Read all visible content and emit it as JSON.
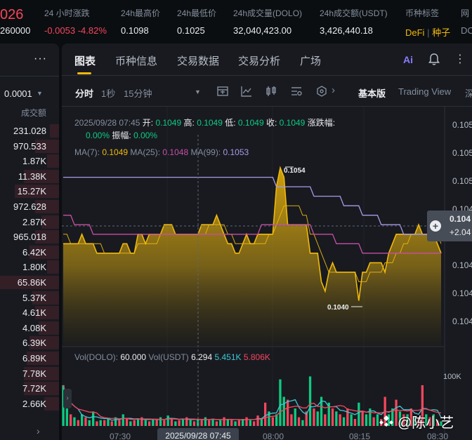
{
  "ticker": {
    "last_price": "026",
    "sub_price": "260000",
    "change_label": "24 小时涨跌",
    "change_value": "-0.0053 -4.82%",
    "high_label": "24h最高价",
    "high_value": "0.1098",
    "low_label": "24h最低价",
    "low_value": "0.1025",
    "vol_base_label": "24h成交量(DOLO)",
    "vol_base_value": "32,040,423.00",
    "vol_quote_label": "24h成交额(USDT)",
    "vol_quote_value": "3,426,440.18",
    "tag_label": "币种标签",
    "tag_defi": "DeFi",
    "tag_sep": "|",
    "tag_seed": "种子",
    "extra_label": "网",
    "extra_value": "DO"
  },
  "orderbook": {
    "menu": "···",
    "step": "0.0001",
    "header": "成交额",
    "rows": [
      "231.028",
      "970.533",
      "1.87K",
      "11.38K",
      "15.27K",
      "972.628",
      "2.87K",
      "965.018",
      "6.42K",
      "1.80K",
      "65.86K",
      "5.37K",
      "4.61K",
      "4.08K",
      "6.39K",
      "6.89K",
      "7.78K",
      "7.72K",
      "2.66K"
    ],
    "bar_fill": [
      0.15,
      0.4,
      0.2,
      0.6,
      0.75,
      0.4,
      0.3,
      0.4,
      0.5,
      0.2,
      1.0,
      0.45,
      0.4,
      0.35,
      0.5,
      0.55,
      0.6,
      0.6,
      0.25
    ],
    "bottom_arrow": "›"
  },
  "tabs": [
    {
      "label": "图表",
      "active": true
    },
    {
      "label": "币种信息"
    },
    {
      "label": "交易数据"
    },
    {
      "label": "交易分析"
    },
    {
      "label": "广场"
    }
  ],
  "tab_actions": {
    "ai": "Ai",
    "more": "⋮"
  },
  "toolbar": {
    "time_label": "分时",
    "sec_label": "1秒",
    "min15_label": "15分钟",
    "dropdown": "▼",
    "basic_label": "基本版",
    "tv_label": "Trading View",
    "depth_label": "深",
    "next": "›"
  },
  "legend": {
    "date": "2025/09/28 07:45",
    "open_label": "开:",
    "open": "0.1049",
    "high_label": "高:",
    "high": "0.1049",
    "low_label": "低:",
    "low": "0.1049",
    "close_label": "收:",
    "close": "0.1049",
    "chg_label": "涨跌幅:",
    "chg": "0.00%",
    "amp_label": "振幅:",
    "amp": "0.00%",
    "ma7_label": "MA(7):",
    "ma7": "0.1049",
    "ma25_label": "MA(25):",
    "ma25": "0.1048",
    "ma99_label": "MA(99):",
    "ma99": "0.1053",
    "vol_label": "Vol(DOLO):",
    "vol": "60.000",
    "volq_label": "Vol(USDT)",
    "volq": "6.294",
    "vol_ma1": "5.451K",
    "vol_ma2": "5.806K"
  },
  "axis": {
    "price_labels": [
      "0.105",
      "0.105",
      "0.105",
      "0.104",
      "0.104",
      "0.104",
      "0.104"
    ],
    "vol_label": "100K",
    "time_labels": [
      "07:30",
      "08:00",
      "08:15",
      "08:30"
    ],
    "hover_date": "2025/09/28 07:45",
    "max_label": "0.1054",
    "min_label": "0.1040"
  },
  "price_tag": {
    "price": "0.104",
    "change": "+2.04"
  },
  "chart_data": {
    "type": "area",
    "ylim": [
      0.1039,
      0.1056
    ],
    "price": [
      0.1046,
      0.1046,
      0.1046,
      0.1046,
      0.1046,
      0.1047,
      0.1046,
      0.1046,
      0.1046,
      0.1045,
      0.1045,
      0.1045,
      0.1045,
      0.1045,
      0.1045,
      0.1045,
      0.1046,
      0.1046,
      0.1045,
      0.1045,
      0.1047,
      0.1047,
      0.1046,
      0.1047,
      0.1047,
      0.1047,
      0.1047,
      0.1048,
      0.1048,
      0.1048,
      0.1047,
      0.1047,
      0.1047,
      0.1047,
      0.1047,
      0.1047,
      0.1047,
      0.1048,
      0.1048,
      0.1048,
      0.1048,
      0.1049,
      0.1048,
      0.1047,
      0.1046,
      0.1046,
      0.1045,
      0.1045,
      0.1046,
      0.1047,
      0.1046,
      0.1046,
      0.1047,
      0.1047,
      0.1047,
      0.1047,
      0.1047,
      0.1052,
      0.1054,
      0.1053,
      0.1048,
      0.1048,
      0.1048,
      0.1048,
      0.1048,
      0.1048,
      0.1045,
      0.1045,
      0.1045,
      0.1042,
      0.1041,
      0.1043,
      0.1044,
      0.1043,
      0.1043,
      0.1043,
      0.1043,
      0.1043,
      0.1043,
      0.104,
      0.1043,
      0.1043,
      0.1044,
      0.1044,
      0.1044,
      0.1044,
      0.1043,
      0.1045,
      0.1046,
      0.1047,
      0.1047,
      0.1047,
      0.1047,
      0.1047,
      0.1047,
      0.1048,
      0.1047,
      0.1047,
      0.1047,
      0.1047,
      0.1046,
      0.1045
    ],
    "ma7": [
      0.1047,
      0.1047,
      0.1046,
      0.1046,
      0.1046,
      0.1046,
      0.1046,
      0.1046,
      0.1046,
      0.1046,
      0.1046,
      0.1045,
      0.1045,
      0.1045,
      0.1045,
      0.1045,
      0.1045,
      0.1045,
      0.1045,
      0.1045,
      0.1046,
      0.1046,
      0.1046,
      0.1046,
      0.1046,
      0.1046,
      0.1047,
      0.1047,
      0.1047,
      0.1047,
      0.1047,
      0.1047,
      0.1047,
      0.1047,
      0.1047,
      0.1047,
      0.1047,
      0.1047,
      0.1047,
      0.1048,
      0.1048,
      0.1048,
      0.1048,
      0.1048,
      0.1047,
      0.1047,
      0.1046,
      0.1046,
      0.1046,
      0.1046,
      0.1046,
      0.1046,
      0.1046,
      0.1046,
      0.1046,
      0.1047,
      0.1047,
      0.1048,
      0.1049,
      0.105,
      0.105,
      0.105,
      0.105,
      0.105,
      0.1049,
      0.1049,
      0.1047,
      0.1047,
      0.1046,
      0.1045,
      0.1044,
      0.1043,
      0.1043,
      0.1043,
      0.1043,
      0.1043,
      0.1043,
      0.1043,
      0.1043,
      0.1042,
      0.1042,
      0.1042,
      0.1043,
      0.1043,
      0.1043,
      0.1043,
      0.1044,
      0.1044,
      0.1044,
      0.1045,
      0.1045,
      0.1046,
      0.1046,
      0.1047,
      0.1047,
      0.1047,
      0.1047,
      0.1047,
      0.1047,
      0.1047,
      0.1047,
      0.1046
    ],
    "ma25": [
      0.1049,
      0.1049,
      0.1049,
      0.1048,
      0.1048,
      0.1048,
      0.1048,
      0.1048,
      0.1047,
      0.1047,
      0.1047,
      0.1047,
      0.1047,
      0.1047,
      0.1047,
      0.1047,
      0.1047,
      0.1047,
      0.1047,
      0.1047,
      0.1047,
      0.1047,
      0.1047,
      0.1047,
      0.1047,
      0.1047,
      0.1047,
      0.1047,
      0.1047,
      0.1047,
      0.1047,
      0.1047,
      0.1047,
      0.1047,
      0.1047,
      0.1047,
      0.1047,
      0.1047,
      0.1047,
      0.1047,
      0.1047,
      0.1047,
      0.1047,
      0.1047,
      0.1047,
      0.1047,
      0.1047,
      0.1047,
      0.1047,
      0.1047,
      0.1047,
      0.1047,
      0.1047,
      0.1048,
      0.1048,
      0.1048,
      0.1048,
      0.1048,
      0.1048,
      0.1048,
      0.1048,
      0.1048,
      0.1048,
      0.1048,
      0.1048,
      0.1048,
      0.1048,
      0.1047,
      0.1047,
      0.1047,
      0.1047,
      0.1047,
      0.1047,
      0.1046,
      0.1046,
      0.1046,
      0.1046,
      0.1046,
      0.1046,
      0.1046,
      0.1045,
      0.1045,
      0.1045,
      0.1045,
      0.1045,
      0.1045,
      0.1045,
      0.1045,
      0.1045,
      0.1045,
      0.1045,
      0.1045,
      0.1045,
      0.1045,
      0.1045,
      0.1045,
      0.1045,
      0.1045,
      0.1045,
      0.1045,
      0.1045,
      0.1045
    ],
    "ma99": [
      0.1053,
      0.1053,
      0.1053,
      0.1053,
      0.1053,
      0.1053,
      0.1053,
      0.1053,
      0.1053,
      0.1053,
      0.1053,
      0.1053,
      0.1053,
      0.1053,
      0.1053,
      0.1053,
      0.1053,
      0.1053,
      0.1053,
      0.1053,
      0.1053,
      0.1053,
      0.1053,
      0.1053,
      0.1053,
      0.1053,
      0.1053,
      0.1053,
      0.1053,
      0.1053,
      0.1053,
      0.1053,
      0.1053,
      0.1053,
      0.1053,
      0.1053,
      0.1053,
      0.1053,
      0.1053,
      0.1053,
      0.1053,
      0.1053,
      0.1053,
      0.1053,
      0.1053,
      0.1053,
      0.1053,
      0.1053,
      0.1053,
      0.1053,
      0.1053,
      0.1053,
      0.1053,
      0.1053,
      0.1053,
      0.1053,
      0.1053,
      0.1052,
      0.1052,
      0.1052,
      0.1052,
      0.1052,
      0.1052,
      0.1052,
      0.1052,
      0.1052,
      0.1052,
      0.1051,
      0.1051,
      0.1051,
      0.1051,
      0.1051,
      0.1051,
      0.1051,
      0.1051,
      0.105,
      0.105,
      0.105,
      0.105,
      0.105,
      0.1049,
      0.1049,
      0.1049,
      0.1049,
      0.1049,
      0.1048,
      0.1048,
      0.1048,
      0.1048,
      0.1048,
      0.1048,
      0.1047,
      0.1047,
      0.1047,
      0.1047,
      0.1047,
      0.1047,
      0.1047,
      0.1047,
      0.1047,
      0.1047,
      0.1047
    ],
    "volume": [
      70,
      30,
      20,
      15,
      10,
      20,
      15,
      10,
      25,
      8,
      10,
      10,
      12,
      8,
      15,
      10,
      20,
      12,
      8,
      10,
      12,
      15,
      10,
      8,
      12,
      10,
      15,
      10,
      18,
      12,
      8,
      10,
      12,
      15,
      10,
      8,
      12,
      10,
      15,
      10,
      12,
      8,
      10,
      15,
      12,
      10,
      8,
      10,
      12,
      15,
      10,
      8,
      18,
      12,
      40,
      25,
      15,
      20,
      80,
      50,
      45,
      20,
      30,
      15,
      10,
      25,
      85,
      30,
      25,
      50,
      20,
      40,
      30,
      25,
      20,
      15,
      30,
      20,
      12,
      40,
      25,
      20,
      30,
      15,
      20,
      12,
      50,
      20,
      30,
      45,
      25,
      20,
      20,
      30,
      15,
      15,
      70,
      20,
      15,
      20,
      10,
      8
    ],
    "volume_up": [
      true,
      true,
      false,
      true,
      false,
      true,
      false,
      true,
      true,
      false,
      true,
      false,
      true,
      false,
      true,
      false,
      true,
      false,
      true,
      false,
      true,
      false,
      true,
      false,
      true,
      false,
      true,
      false,
      true,
      false,
      true,
      false,
      true,
      false,
      true,
      false,
      true,
      false,
      true,
      false,
      true,
      false,
      true,
      false,
      true,
      false,
      true,
      false,
      true,
      false,
      true,
      false,
      false,
      true,
      false,
      true,
      false,
      true,
      true,
      true,
      false,
      false,
      true,
      false,
      true,
      false,
      true,
      false,
      true,
      true,
      false,
      true,
      false,
      true,
      false,
      true,
      false,
      true,
      false,
      true,
      false,
      true,
      true,
      false,
      true,
      false,
      false,
      true,
      true,
      false,
      true,
      false,
      true,
      false,
      true,
      false,
      false,
      true,
      false,
      true,
      false,
      true
    ],
    "vol_ylim": [
      0,
      100
    ],
    "xlabel": "",
    "ylabel": ""
  },
  "colors": {
    "accent": "#f0b90b",
    "up": "#0ecb81",
    "down": "#f6465d",
    "ma7": "#f0b90b",
    "ma25": "#c84ea3",
    "ma99": "#a89be6",
    "vol_ma1": "#3fc7d4",
    "vol_ma2": "#f6465d"
  },
  "watermark": "@陈小艺"
}
